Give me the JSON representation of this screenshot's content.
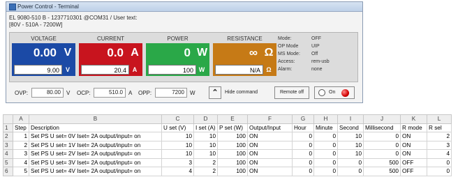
{
  "window": {
    "title": "Power Control - Terminal",
    "info_line1": "EL 9080-510 B - 1237710301 @COM31 / User text:",
    "info_line2": "[80V - 510A - 7200W]"
  },
  "columns": {
    "voltage": {
      "label": "VOLTAGE",
      "actual": "0.00",
      "unit": "V",
      "set": "9.00",
      "color": "#1b4aa6"
    },
    "current": {
      "label": "CURRENT",
      "actual": "0.0",
      "unit": "A",
      "set": "20.4",
      "color": "#c8141e"
    },
    "power": {
      "label": "POWER",
      "actual": "0",
      "unit": "W",
      "set": "100",
      "color": "#2aa848"
    },
    "resistance": {
      "label": "RESISTANCE",
      "actual": "∞",
      "unit": "Ω",
      "set": "N/A",
      "color": "#c67a16"
    }
  },
  "status": [
    {
      "key": "Mode:",
      "value": "OFF"
    },
    {
      "key": "OP Mode",
      "value": "UIP"
    },
    {
      "key": "MS Mode:",
      "value": "Off"
    },
    {
      "key": "Access:",
      "value": "rem-usb"
    },
    {
      "key": "Alarm:",
      "value": "none"
    }
  ],
  "protection": {
    "ovp_label": "OVP:",
    "ovp_value": "80.00",
    "ovp_unit": "V",
    "ocp_label": "OCP:",
    "ocp_value": "510.0",
    "ocp_unit": "A",
    "opp_label": "OPP:",
    "opp_value": "7200",
    "opp_unit": "W"
  },
  "controls": {
    "hide_icon": "double-chevron-up-icon",
    "hide_label": "Hide command",
    "remote_label": "Remote off",
    "on_label": "On"
  },
  "sheet": {
    "col_letters": [
      "",
      "A",
      "B",
      "C",
      "D",
      "E",
      "F",
      "G",
      "H",
      "I",
      "J",
      "K",
      "L"
    ],
    "headers": [
      "Step",
      "Description",
      "U set (V)",
      "I set (A)",
      "P set (W)",
      "Output/Input",
      "Hour",
      "Minute",
      "Second",
      "Millisecond",
      "R mode",
      "R sel"
    ],
    "rows": [
      [
        "1",
        "Set PS U set= 0V Iset= 2A output/input= on",
        "10",
        "10",
        "100",
        "ON",
        "0",
        "0",
        "10",
        "0",
        "ON",
        "2"
      ],
      [
        "2",
        "Set PS U set= 1V Iset= 2A output/input= on",
        "10",
        "10",
        "100",
        "ON",
        "0",
        "0",
        "10",
        "0",
        "ON",
        "3"
      ],
      [
        "3",
        "Set PS U set= 2V Iset= 2A output/input= on",
        "10",
        "10",
        "100",
        "ON",
        "0",
        "0",
        "10",
        "0",
        "ON",
        "4"
      ],
      [
        "4",
        "Set PS U set= 3V Iset= 2A output/input= on",
        "3",
        "2",
        "100",
        "ON",
        "0",
        "0",
        "0",
        "500",
        "OFF",
        "0"
      ],
      [
        "5",
        "Set PS U set= 4V Iset= 2A output/input= on",
        "4",
        "2",
        "100",
        "ON",
        "0",
        "0",
        "0",
        "500",
        "OFF",
        "0"
      ]
    ]
  }
}
